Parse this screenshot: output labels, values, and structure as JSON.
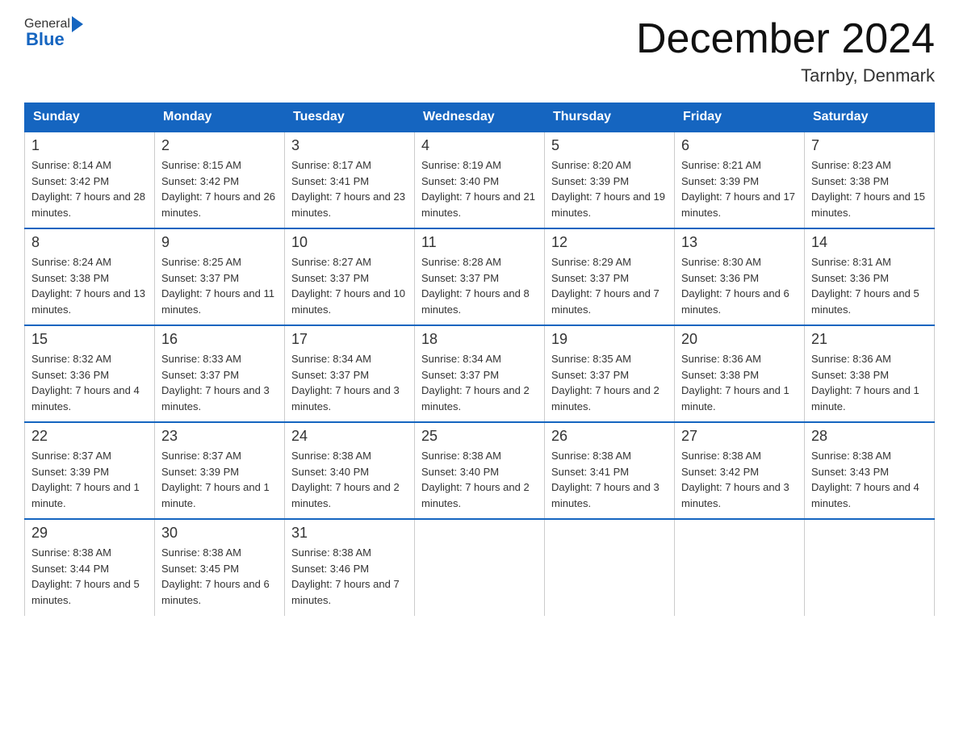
{
  "header": {
    "logo_general": "General",
    "logo_blue": "Blue",
    "title": "December 2024",
    "location": "Tarnby, Denmark"
  },
  "days_of_week": [
    "Sunday",
    "Monday",
    "Tuesday",
    "Wednesday",
    "Thursday",
    "Friday",
    "Saturday"
  ],
  "weeks": [
    [
      {
        "num": "1",
        "sunrise": "8:14 AM",
        "sunset": "3:42 PM",
        "daylight": "7 hours and 28 minutes."
      },
      {
        "num": "2",
        "sunrise": "8:15 AM",
        "sunset": "3:42 PM",
        "daylight": "7 hours and 26 minutes."
      },
      {
        "num": "3",
        "sunrise": "8:17 AM",
        "sunset": "3:41 PM",
        "daylight": "7 hours and 23 minutes."
      },
      {
        "num": "4",
        "sunrise": "8:19 AM",
        "sunset": "3:40 PM",
        "daylight": "7 hours and 21 minutes."
      },
      {
        "num": "5",
        "sunrise": "8:20 AM",
        "sunset": "3:39 PM",
        "daylight": "7 hours and 19 minutes."
      },
      {
        "num": "6",
        "sunrise": "8:21 AM",
        "sunset": "3:39 PM",
        "daylight": "7 hours and 17 minutes."
      },
      {
        "num": "7",
        "sunrise": "8:23 AM",
        "sunset": "3:38 PM",
        "daylight": "7 hours and 15 minutes."
      }
    ],
    [
      {
        "num": "8",
        "sunrise": "8:24 AM",
        "sunset": "3:38 PM",
        "daylight": "7 hours and 13 minutes."
      },
      {
        "num": "9",
        "sunrise": "8:25 AM",
        "sunset": "3:37 PM",
        "daylight": "7 hours and 11 minutes."
      },
      {
        "num": "10",
        "sunrise": "8:27 AM",
        "sunset": "3:37 PM",
        "daylight": "7 hours and 10 minutes."
      },
      {
        "num": "11",
        "sunrise": "8:28 AM",
        "sunset": "3:37 PM",
        "daylight": "7 hours and 8 minutes."
      },
      {
        "num": "12",
        "sunrise": "8:29 AM",
        "sunset": "3:37 PM",
        "daylight": "7 hours and 7 minutes."
      },
      {
        "num": "13",
        "sunrise": "8:30 AM",
        "sunset": "3:36 PM",
        "daylight": "7 hours and 6 minutes."
      },
      {
        "num": "14",
        "sunrise": "8:31 AM",
        "sunset": "3:36 PM",
        "daylight": "7 hours and 5 minutes."
      }
    ],
    [
      {
        "num": "15",
        "sunrise": "8:32 AM",
        "sunset": "3:36 PM",
        "daylight": "7 hours and 4 minutes."
      },
      {
        "num": "16",
        "sunrise": "8:33 AM",
        "sunset": "3:37 PM",
        "daylight": "7 hours and 3 minutes."
      },
      {
        "num": "17",
        "sunrise": "8:34 AM",
        "sunset": "3:37 PM",
        "daylight": "7 hours and 3 minutes."
      },
      {
        "num": "18",
        "sunrise": "8:34 AM",
        "sunset": "3:37 PM",
        "daylight": "7 hours and 2 minutes."
      },
      {
        "num": "19",
        "sunrise": "8:35 AM",
        "sunset": "3:37 PM",
        "daylight": "7 hours and 2 minutes."
      },
      {
        "num": "20",
        "sunrise": "8:36 AM",
        "sunset": "3:38 PM",
        "daylight": "7 hours and 1 minute."
      },
      {
        "num": "21",
        "sunrise": "8:36 AM",
        "sunset": "3:38 PM",
        "daylight": "7 hours and 1 minute."
      }
    ],
    [
      {
        "num": "22",
        "sunrise": "8:37 AM",
        "sunset": "3:39 PM",
        "daylight": "7 hours and 1 minute."
      },
      {
        "num": "23",
        "sunrise": "8:37 AM",
        "sunset": "3:39 PM",
        "daylight": "7 hours and 1 minute."
      },
      {
        "num": "24",
        "sunrise": "8:38 AM",
        "sunset": "3:40 PM",
        "daylight": "7 hours and 2 minutes."
      },
      {
        "num": "25",
        "sunrise": "8:38 AM",
        "sunset": "3:40 PM",
        "daylight": "7 hours and 2 minutes."
      },
      {
        "num": "26",
        "sunrise": "8:38 AM",
        "sunset": "3:41 PM",
        "daylight": "7 hours and 3 minutes."
      },
      {
        "num": "27",
        "sunrise": "8:38 AM",
        "sunset": "3:42 PM",
        "daylight": "7 hours and 3 minutes."
      },
      {
        "num": "28",
        "sunrise": "8:38 AM",
        "sunset": "3:43 PM",
        "daylight": "7 hours and 4 minutes."
      }
    ],
    [
      {
        "num": "29",
        "sunrise": "8:38 AM",
        "sunset": "3:44 PM",
        "daylight": "7 hours and 5 minutes."
      },
      {
        "num": "30",
        "sunrise": "8:38 AM",
        "sunset": "3:45 PM",
        "daylight": "7 hours and 6 minutes."
      },
      {
        "num": "31",
        "sunrise": "8:38 AM",
        "sunset": "3:46 PM",
        "daylight": "7 hours and 7 minutes."
      },
      null,
      null,
      null,
      null
    ]
  ]
}
